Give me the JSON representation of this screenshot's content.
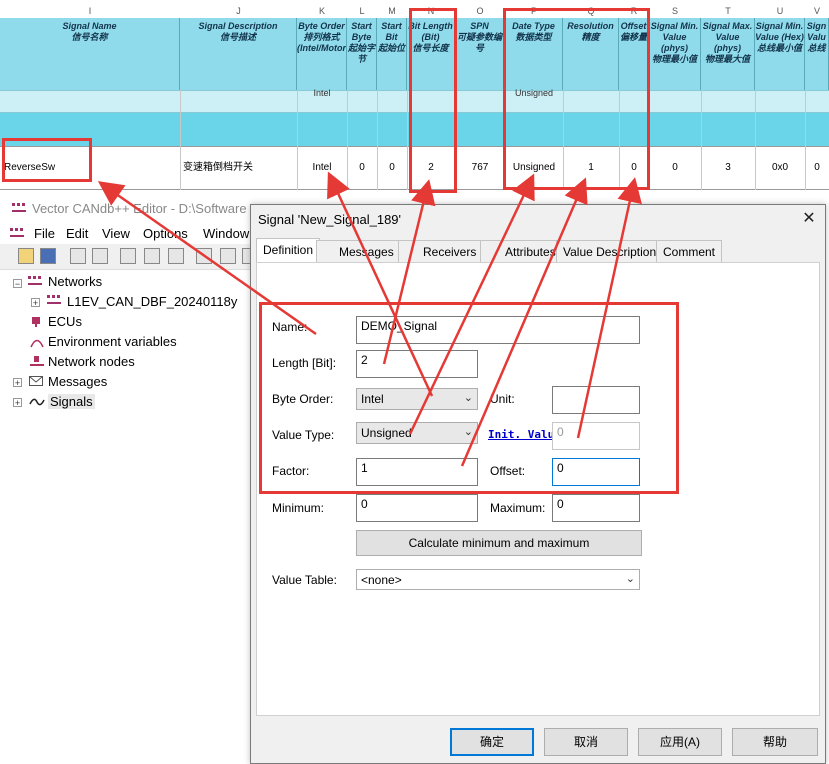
{
  "sheet": {
    "col_letters": [
      "I",
      "J",
      "K",
      "L",
      "M",
      "N",
      "O",
      "P",
      "Q",
      "R",
      "S",
      "T",
      "U",
      "V"
    ],
    "headers": [
      {
        "en": "Signal Name",
        "zh": "信号名称"
      },
      {
        "en": "Signal Description",
        "zh": "信号描述"
      },
      {
        "en": "Byte Order",
        "zh": "排列格式(Intel/Motorola)"
      },
      {
        "en": "Start Byte",
        "zh": "起始字节"
      },
      {
        "en": "Start Bit",
        "zh": "起始位"
      },
      {
        "en": "Bit Length (Bit)",
        "zh": "信号长度"
      },
      {
        "en": "SPN",
        "zh": "可疑参数编号"
      },
      {
        "en": "Date Type",
        "zh": "数据类型"
      },
      {
        "en": "Resolution",
        "zh": "精度"
      },
      {
        "en": "Offset",
        "zh": "偏移量"
      },
      {
        "en": "Signal Min. Value (phys)",
        "zh": "物理最小值"
      },
      {
        "en": "Signal Max. Value (phys)",
        "zh": "物理最大值"
      },
      {
        "en": "Signal Min. Value (Hex)",
        "zh": "总线最小值"
      },
      {
        "en": "Sign Valu",
        "zh": "总线"
      }
    ],
    "partial_row": [
      "Intel",
      "Unsigned"
    ],
    "row": {
      "name": "ReverseSw",
      "desc": "变速箱倒档开关",
      "byte_order": "Intel",
      "start_byte": "0",
      "start_bit": "0",
      "bit_length": "2",
      "spn": "767",
      "data_type": "Unsigned",
      "resolution": "1",
      "offset": "0",
      "min_phys": "0",
      "max_phys": "3",
      "min_hex": "0x0",
      "extra": "0"
    }
  },
  "candb": {
    "title": "Vector CANdb++ Editor - D:\\Software",
    "menu": [
      "File",
      "Edit",
      "View",
      "Options",
      "Window"
    ],
    "tree": [
      {
        "label": "Networks",
        "icon": "network-icon",
        "expanded": true
      },
      {
        "label": "L1EV_CAN_DBF_20240118y",
        "icon": "bus-icon",
        "child": true
      },
      {
        "label": "ECUs",
        "icon": "ecu-icon"
      },
      {
        "label": "Environment variables",
        "icon": "env-var-icon"
      },
      {
        "label": "Network nodes",
        "icon": "node-icon"
      },
      {
        "label": "Messages",
        "icon": "message-icon"
      },
      {
        "label": "Signals",
        "icon": "signal-icon"
      }
    ]
  },
  "dialog": {
    "title": "Signal 'New_Signal_189'",
    "tabs": [
      "Definition",
      "Messages",
      "Receivers",
      "Attributes",
      "Value Descriptions",
      "Comment"
    ],
    "labels": {
      "name": "Name:",
      "length": "Length [Bit]:",
      "byte_order": "Byte Order:",
      "unit": "Unit:",
      "value_type": "Value Type:",
      "init_value": "Init. Value",
      "factor": "Factor:",
      "offset": "Offset:",
      "minimum": "Minimum:",
      "maximum": "Maximum:",
      "value_table": "Value Table:"
    },
    "values": {
      "name": "DEMO_Signal",
      "length": "2",
      "byte_order": "Intel",
      "unit": "",
      "value_type": "Unsigned",
      "init_value": "0",
      "factor": "1",
      "offset": "0",
      "minimum": "0",
      "maximum": "0",
      "value_table": "<none>"
    },
    "calc_button": "Calculate minimum and maximum",
    "buttons": {
      "ok": "确定",
      "cancel": "取消",
      "apply": "应用(A)",
      "help": "帮助"
    }
  },
  "colors": {
    "annotation": "#e53935",
    "header_bg": "#8fdbeb",
    "row_cyan": "#6ad4e8"
  }
}
